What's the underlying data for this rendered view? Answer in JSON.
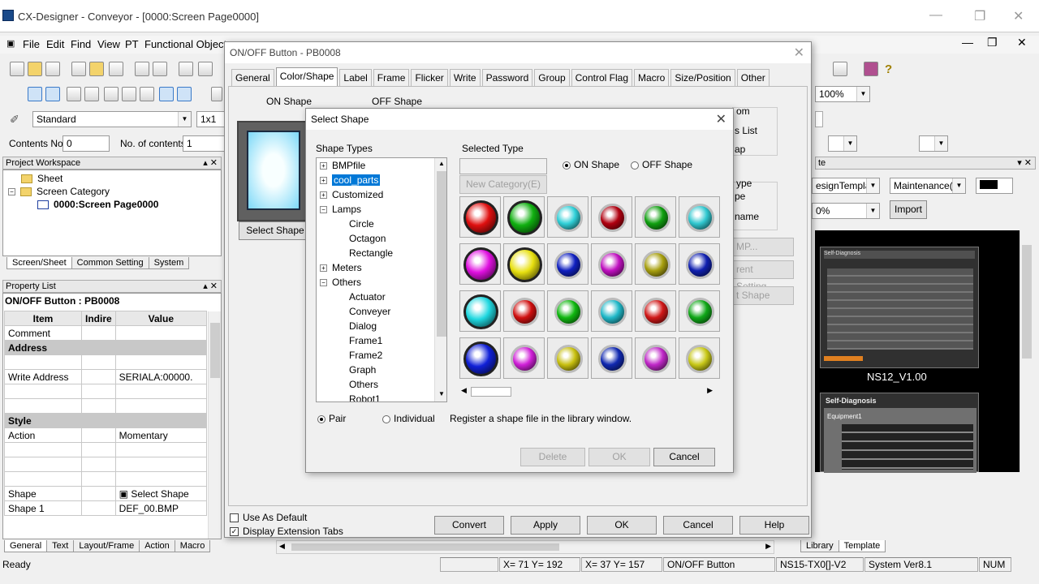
{
  "app": {
    "title": "CX-Designer - Conveyor - [0000:Screen Page0000]",
    "window_controls": [
      "—",
      "❐",
      "✕"
    ]
  },
  "menu": [
    "File",
    "Edit",
    "Find",
    "View",
    "PT",
    "Functional Objects"
  ],
  "toolbar": {
    "style": "Standard",
    "zoom_combo": "1x1",
    "contents_no_label": "Contents No.",
    "contents_no_value": "0",
    "no_of_contents_label": "No. of contents",
    "no_of_contents_value": "1",
    "zoom": "100%"
  },
  "project": {
    "header": "Project Workspace",
    "items": [
      "Sheet",
      "Screen Category",
      "0000:Screen Page0000"
    ],
    "tabs": [
      "Screen/Sheet",
      "Common Setting",
      "System"
    ]
  },
  "property": {
    "header": "Property List",
    "object": "ON/OFF Button : PB0008",
    "columns": [
      "Item",
      "Indire",
      "Value"
    ],
    "rows": [
      [
        "Comment",
        "",
        ""
      ],
      [
        "Address",
        "",
        ""
      ],
      [
        "",
        "",
        ""
      ],
      [
        "Write Address",
        "",
        "SERIALA:00000."
      ],
      [
        "",
        "",
        ""
      ],
      [
        "",
        "",
        ""
      ],
      [
        "Style",
        "",
        ""
      ],
      [
        "Action",
        "",
        "Momentary"
      ],
      [
        "",
        "",
        ""
      ],
      [
        "",
        "",
        ""
      ],
      [
        "",
        "",
        ""
      ],
      [
        "Shape",
        "",
        "Select Shape"
      ],
      [
        "Shape 1",
        "",
        "DEF_00.BMP"
      ]
    ],
    "tabs": [
      "General",
      "Text",
      "Layout/Frame",
      "Action",
      "Macro"
    ]
  },
  "dialog": {
    "title": "ON/OFF Button - PB0008",
    "tabs": [
      "General",
      "Color/Shape",
      "Label",
      "Frame",
      "Flicker",
      "Write",
      "Password",
      "Group",
      "Control Flag",
      "Macro",
      "Size/Position",
      "Other"
    ],
    "on_shape": "ON Shape",
    "off_shape": "OFF Shape",
    "select_shape_btn": "Select Shape",
    "right_labels": [
      "om",
      "s List",
      "ap",
      "ype",
      "pe",
      "name",
      "MP...",
      "rent Setting...",
      "t Shape"
    ],
    "use_as_default": "Use As Default",
    "display_ext_tabs": "Display Extension Tabs",
    "buttons": [
      "Convert",
      "Apply",
      "OK",
      "Cancel",
      "Help"
    ]
  },
  "select_shape": {
    "title": "Select Shape",
    "shape_types_label": "Shape Types",
    "selected_type_label": "Selected Type",
    "new_category": "New Category(E)",
    "on_shape": "ON Shape",
    "off_shape": "OFF Shape",
    "pair": "Pair",
    "individual": "Individual",
    "register_text": "Register a shape file in the library window.",
    "buttons": [
      "Delete",
      "OK",
      "Cancel"
    ],
    "tree": [
      {
        "label": "BMPfile",
        "exp": "+",
        "lvl": 0
      },
      {
        "label": "cool_parts",
        "exp": "+",
        "lvl": 0,
        "sel": true
      },
      {
        "label": "Customized",
        "exp": "+",
        "lvl": 0
      },
      {
        "label": "Lamps",
        "exp": "-",
        "lvl": 0
      },
      {
        "label": "Circle",
        "lvl": 1
      },
      {
        "label": "Octagon",
        "lvl": 1
      },
      {
        "label": "Rectangle",
        "lvl": 1
      },
      {
        "label": "Meters",
        "exp": "+",
        "lvl": 0
      },
      {
        "label": "Others",
        "exp": "-",
        "lvl": 0
      },
      {
        "label": "Actuator",
        "lvl": 1
      },
      {
        "label": "Conveyer",
        "lvl": 1
      },
      {
        "label": "Dialog",
        "lvl": 1
      },
      {
        "label": "Frame1",
        "lvl": 1
      },
      {
        "label": "Frame2",
        "lvl": 1
      },
      {
        "label": "Graph",
        "lvl": 1
      },
      {
        "label": "Others",
        "lvl": 1
      },
      {
        "label": "Robot1",
        "lvl": 1
      }
    ],
    "lamps": [
      [
        "#e01010",
        "#10b010",
        "#30d0d8",
        "#b00010",
        "#10a010",
        "#30c8d0"
      ],
      [
        "#e010e0",
        "#e8e010",
        "#1020c0",
        "#c010c0",
        "#a8a010",
        "#1020b0"
      ],
      [
        "#20d8e0",
        "#d01010",
        "#10b810",
        "#20b8c8",
        "#d01818",
        "#10a818"
      ],
      [
        "#1020d8",
        "#d020d8",
        "#c8c010",
        "#1028b0",
        "#c028c8",
        "#c8c818"
      ]
    ],
    "lamp_style": [
      [
        1,
        1,
        2,
        2,
        2,
        2
      ],
      [
        1,
        1,
        2,
        2,
        2,
        2
      ],
      [
        1,
        2,
        2,
        2,
        2,
        2
      ],
      [
        1,
        2,
        2,
        2,
        2,
        2
      ]
    ]
  },
  "library": {
    "combo1": "esignTemplat",
    "combo2": "Maintenance(C",
    "combo3": "0%",
    "import": "Import",
    "caption1": "NS12_V1.00",
    "caption2": "Self-Diagnosis",
    "caption3": "Equipment1",
    "caption_top": "Self-Diagnosis",
    "tabs": [
      "Library",
      "Template"
    ]
  },
  "status": {
    "ready": "Ready",
    "xy1": "X=  71 Y= 192",
    "xy2": "X=  37 Y= 157",
    "obj": "ON/OFF Button",
    "model": "NS15-TX0[]-V2",
    "sys": "System Ver8.1",
    "num": "NUM"
  }
}
